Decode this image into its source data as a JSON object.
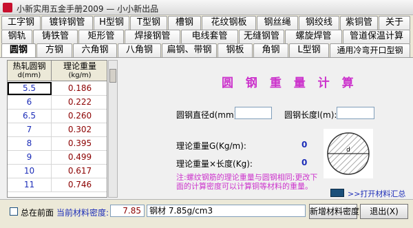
{
  "window": {
    "title": "小新实用五金手册2009 — 小小新出品"
  },
  "tabs": {
    "row1": [
      "工字钢",
      "镀锌钢管",
      "H型钢",
      "T型钢",
      "槽钢",
      "花纹钢板",
      "钢丝绳",
      "钢绞线",
      "紫铜管",
      "关于"
    ],
    "row2": [
      "钢轨",
      "铸铁管",
      "矩形管",
      "焊接钢管",
      "电线套管",
      "无缝钢管",
      "螺旋焊管",
      "管道保温计算"
    ],
    "row3": [
      "圆钢",
      "方钢",
      "六角钢",
      "八角钢",
      "扁钢、带钢",
      "钢板",
      "角钢",
      "L型钢",
      "通用冷弯开口型钢"
    ],
    "active": "圆钢"
  },
  "table": {
    "headers": [
      {
        "title": "热轧圆钢",
        "unit": "d(mm)"
      },
      {
        "title": "理论重量",
        "unit": "(kg/m)"
      }
    ],
    "rows": [
      {
        "d": "5.5",
        "w": "0.186"
      },
      {
        "d": "6",
        "w": "0.222"
      },
      {
        "d": "6.5",
        "w": "0.260"
      },
      {
        "d": "7",
        "w": "0.302"
      },
      {
        "d": "8",
        "w": "0.395"
      },
      {
        "d": "9",
        "w": "0.499"
      },
      {
        "d": "10",
        "w": "0.617"
      },
      {
        "d": "11",
        "w": "0.746"
      }
    ]
  },
  "calc": {
    "title": "圆 钢 重 量 计 算",
    "diameter_label": "圆钢直径d(mm):",
    "length_label": "圆钢长度l(m):",
    "weight_label": "理论重量G(Kg/m):",
    "weight_value": "0",
    "total_label": "理论重量×长度(Kg):",
    "total_value": "0",
    "diagram_label": "d",
    "note": "注:螺纹钢筋的理论重量与圆钢相同;更改下面的计算密度可以计算铜等材料的重量。",
    "summary_link": ">>打开材料汇总"
  },
  "footer": {
    "front_label": "总在前面",
    "density_label": "当前材料密度:",
    "density_value": "7.85",
    "material_value": "钢材 7.85g/cm3",
    "new_button": "新增材料密度",
    "exit_button": "退出(X)"
  },
  "colors": {
    "accent": "#cc33cc",
    "value_blue": "#1c2db8",
    "weight_red": "#8b0000"
  }
}
